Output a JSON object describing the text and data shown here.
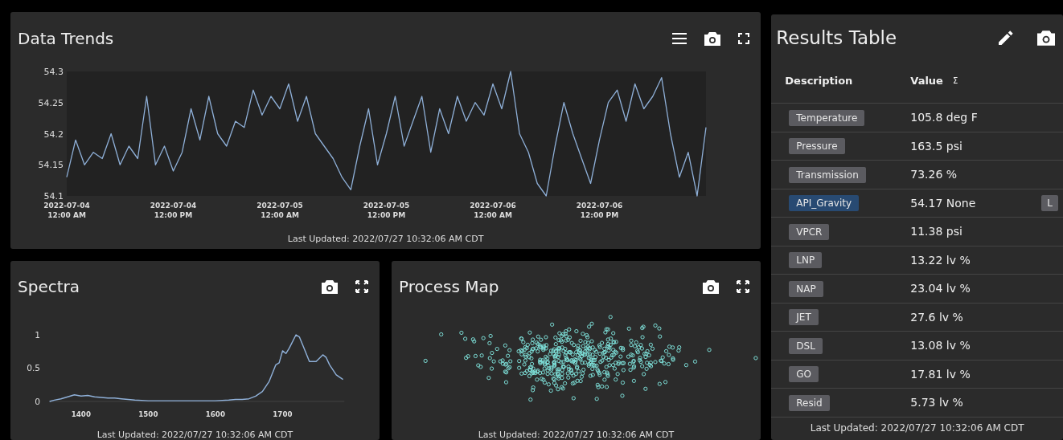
{
  "data_trends": {
    "title": "Data Trends",
    "footer": "Last Updated: 2022/07/27 10:32:06 AM CDT",
    "chart_data": {
      "type": "line",
      "categories": [
        "2022-07-04 12:00 AM",
        null,
        null,
        null,
        null,
        null,
        null,
        null,
        null,
        null,
        null,
        null,
        "2022-07-04 12:00 PM",
        null,
        null,
        null,
        null,
        null,
        null,
        null,
        null,
        null,
        null,
        null,
        "2022-07-05 12:00 AM",
        null,
        null,
        null,
        null,
        null,
        null,
        null,
        null,
        null,
        null,
        null,
        "2022-07-05 12:00 PM",
        null,
        null,
        null,
        null,
        null,
        null,
        null,
        null,
        null,
        null,
        null,
        "2022-07-06 12:00 AM",
        null,
        null,
        null,
        null,
        null,
        null,
        null,
        null,
        null,
        null,
        null,
        "2022-07-06 12:00 PM",
        null,
        null,
        null,
        null,
        null,
        null,
        null,
        null,
        null,
        null,
        null,
        null
      ],
      "series": [
        {
          "color": "#8fb0d8",
          "values": [
            54.13,
            54.19,
            54.15,
            54.17,
            54.16,
            54.2,
            54.15,
            54.18,
            54.16,
            54.26,
            54.15,
            54.18,
            54.14,
            54.17,
            54.24,
            54.19,
            54.26,
            54.2,
            54.18,
            54.22,
            54.21,
            54.27,
            54.23,
            54.26,
            54.24,
            54.28,
            54.22,
            54.26,
            54.2,
            54.18,
            54.16,
            54.13,
            54.11,
            54.18,
            54.24,
            54.15,
            54.2,
            54.26,
            54.18,
            54.22,
            54.26,
            54.17,
            54.24,
            54.2,
            54.26,
            54.22,
            54.25,
            54.23,
            54.28,
            54.24,
            54.3,
            54.2,
            54.17,
            54.12,
            54.1,
            54.18,
            54.25,
            54.2,
            54.16,
            54.12,
            54.19,
            54.25,
            54.27,
            54.22,
            54.28,
            54.24,
            54.26,
            54.29,
            54.2,
            54.13,
            54.17,
            54.1,
            54.21
          ]
        }
      ],
      "ylim": [
        54.1,
        54.3
      ],
      "yticks": [
        54.1,
        54.15,
        {
          "value": 54.2,
          "label": "54.2"
        },
        54.25,
        {
          "value": 54.3,
          "label": "54.3"
        }
      ]
    }
  },
  "spectra": {
    "title": "Spectra",
    "footer": "Last Updated: 2022/07/27 10:32:06 AM CDT",
    "chart_data": {
      "type": "line",
      "x": [
        1353,
        1360,
        1370,
        1380,
        1390,
        1400,
        1410,
        1420,
        1430,
        1440,
        1450,
        1460,
        1470,
        1480,
        1500,
        1520,
        1550,
        1580,
        1600,
        1620,
        1630,
        1640,
        1650,
        1660,
        1670,
        1680,
        1690,
        1695,
        1700,
        1705,
        1710,
        1720,
        1725,
        1730,
        1740,
        1750,
        1760,
        1765,
        1770,
        1780,
        1790
      ],
      "series": [
        {
          "color": "#8fb0d8",
          "values": [
            0,
            0.02,
            0.04,
            0.07,
            0.1,
            0.08,
            0.09,
            0.07,
            0.06,
            0.05,
            0.05,
            0.04,
            0.03,
            0.02,
            0.01,
            0.01,
            0.01,
            0.01,
            0.01,
            0.02,
            0.03,
            0.03,
            0.04,
            0.08,
            0.15,
            0.3,
            0.55,
            0.58,
            0.76,
            0.72,
            0.8,
            1.0,
            0.97,
            0.85,
            0.6,
            0.6,
            0.7,
            0.66,
            0.55,
            0.4,
            0.33
          ]
        }
      ],
      "xlim": [
        1353,
        1792
      ],
      "ylim": [
        0,
        1
      ],
      "xticks": [
        1400,
        1500,
        1600,
        1700
      ],
      "yticks": [
        0,
        0.5,
        1
      ]
    }
  },
  "process_map": {
    "title": "Process Map",
    "footer": "Last Updated: 2022/07/27 10:32:06 AM CDT"
  },
  "results_table": {
    "title": "Results Table",
    "columns": [
      {
        "label": "Description"
      },
      {
        "label": "Value",
        "symbol": "Σ"
      }
    ],
    "rows": [
      {
        "label": "Temperature",
        "value": "105.8 deg F",
        "selected": false
      },
      {
        "label": "Pressure",
        "value": "163.5 psi",
        "selected": false
      },
      {
        "label": "Transmission",
        "value": "73.26 %",
        "selected": false
      },
      {
        "label": "API_Gravity",
        "value": "54.17 None",
        "selected": true,
        "badge": "L"
      },
      {
        "label": "VPCR",
        "value": "11.38 psi",
        "selected": false
      },
      {
        "label": "LNP",
        "value": "13.22 lv %",
        "selected": false
      },
      {
        "label": "NAP",
        "value": "23.04 lv %",
        "selected": false
      },
      {
        "label": "JET",
        "value": "27.6 lv %",
        "selected": false
      },
      {
        "label": "DSL",
        "value": "13.08 lv %",
        "selected": false
      },
      {
        "label": "GO",
        "value": "17.81 lv %",
        "selected": false
      },
      {
        "label": "Resid",
        "value": "5.73 lv %",
        "selected": false
      }
    ],
    "footer": "Last Updated: 2022/07/27 10:32:06 AM CDT"
  }
}
